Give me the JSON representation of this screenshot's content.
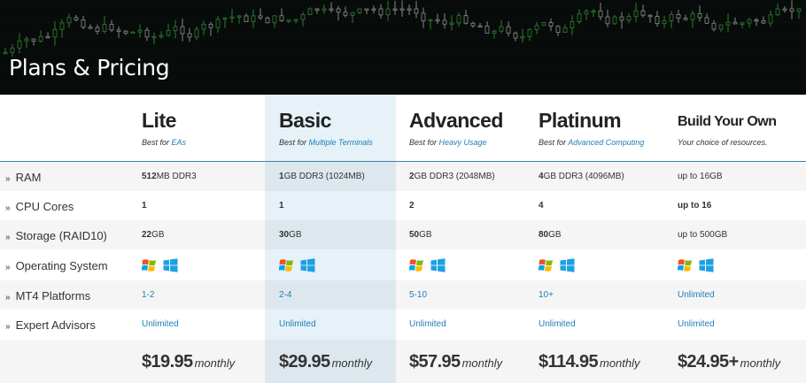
{
  "page_title": "Plans & Pricing",
  "plans": [
    {
      "name": "Lite",
      "sub_prefix": "Best for ",
      "sub_highlight": "EAs",
      "price": "$19.95",
      "period": "monthly"
    },
    {
      "name": "Basic",
      "sub_prefix": "Best for ",
      "sub_highlight": "Multiple Terminals",
      "price": "$29.95",
      "period": "monthly"
    },
    {
      "name": "Advanced",
      "sub_prefix": "Best for ",
      "sub_highlight": "Heavy Usage",
      "price": "$57.95",
      "period": "monthly"
    },
    {
      "name": "Platinum",
      "sub_prefix": "Best for ",
      "sub_highlight": "Advanced Computing",
      "price": "$114.95",
      "period": "monthly"
    },
    {
      "name": "Build Your Own",
      "sub_prefix": "Your choice of resources.",
      "sub_highlight": "",
      "price": "$24.95+",
      "period": "monthly"
    }
  ],
  "rows": {
    "ram": {
      "label": "RAM",
      "values": [
        {
          "bold": "512",
          "rest": "MB DDR3"
        },
        {
          "bold": "1",
          "rest": "GB DDR3 (1024MB)"
        },
        {
          "bold": "2",
          "rest": "GB DDR3 (2048MB)"
        },
        {
          "bold": "4",
          "rest": "GB DDR3 (4096MB)"
        },
        {
          "bold": "",
          "rest": "up to 16GB"
        }
      ]
    },
    "cpu": {
      "label": "CPU Cores",
      "values": [
        {
          "bold": "1",
          "rest": ""
        },
        {
          "bold": "1",
          "rest": ""
        },
        {
          "bold": "2",
          "rest": ""
        },
        {
          "bold": "4",
          "rest": ""
        },
        {
          "bold": "up to 16",
          "rest": ""
        }
      ]
    },
    "storage": {
      "label": "Storage (RAID10)",
      "values": [
        {
          "bold": "22",
          "rest": "GB"
        },
        {
          "bold": "30",
          "rest": "GB"
        },
        {
          "bold": "50",
          "rest": "GB"
        },
        {
          "bold": "80",
          "rest": "GB"
        },
        {
          "bold": "",
          "rest": "up to 500GB"
        }
      ]
    },
    "os": {
      "label": "Operating System",
      "icons": [
        "windows-flag-icon",
        "windows-tiles-icon"
      ]
    },
    "mt4": {
      "label": "MT4 Platforms",
      "values": [
        "1-2",
        "2-4",
        "5-10",
        "10+",
        "Unlimited"
      ]
    },
    "ea": {
      "label": "Expert Advisors",
      "values": [
        "Unlimited",
        "Unlimited",
        "Unlimited",
        "Unlimited",
        "Unlimited"
      ]
    }
  },
  "colors": {
    "accent": "#1f7fb3",
    "divider": "#3d84b3",
    "highlight_column": "#e6f2f8",
    "banner": "#070b09"
  }
}
